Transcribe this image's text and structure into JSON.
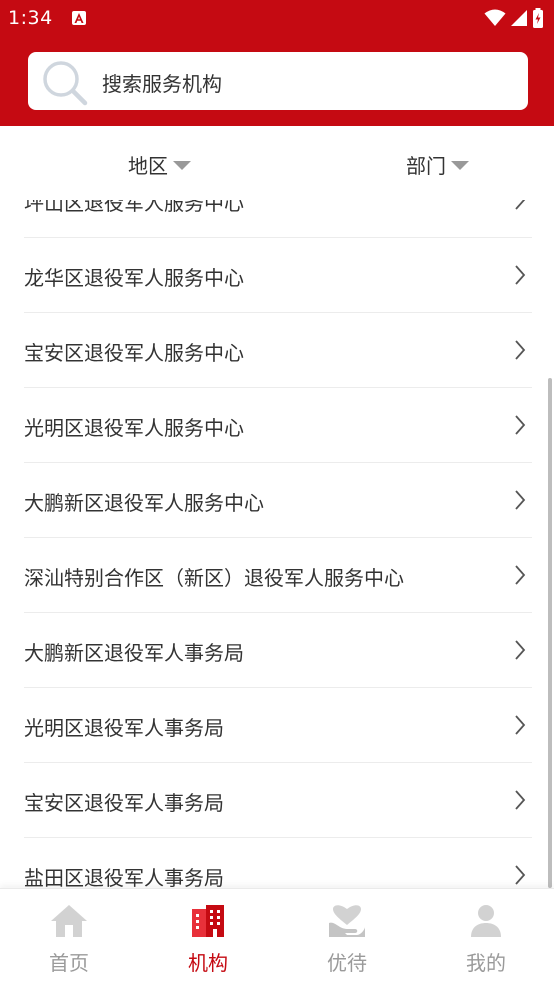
{
  "status": {
    "time": "1:34"
  },
  "search": {
    "placeholder": "搜索服务机构"
  },
  "filters": {
    "region": "地区",
    "department": "部门"
  },
  "list": {
    "items": [
      "坪山区退役军人服务中心",
      "龙华区退役军人服务中心",
      "宝安区退役军人服务中心",
      "光明区退役军人服务中心",
      "大鹏新区退役军人服务中心",
      "深汕特别合作区（新区）退役军人服务中心",
      "大鹏新区退役军人事务局",
      "光明区退役军人事务局",
      "宝安区退役军人事务局",
      "盐田区退役军人事务局"
    ]
  },
  "tabs": [
    {
      "label": "首页",
      "icon": "home-icon",
      "active": false
    },
    {
      "label": "机构",
      "icon": "building-icon",
      "active": true
    },
    {
      "label": "优待",
      "icon": "care-icon",
      "active": false
    },
    {
      "label": "我的",
      "icon": "user-icon",
      "active": false
    }
  ],
  "colors": {
    "accent": "#c50a12",
    "inactive": "#9a9a9a"
  }
}
